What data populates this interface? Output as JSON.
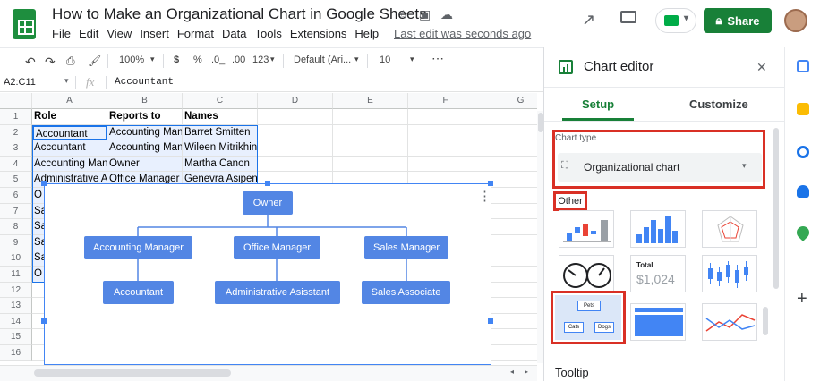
{
  "doc": {
    "title": "How to Make an Organizational Chart in Google Sheets",
    "last_edit": "Last edit was seconds ago"
  },
  "menu": [
    "File",
    "Edit",
    "View",
    "Insert",
    "Format",
    "Data",
    "Tools",
    "Extensions",
    "Help"
  ],
  "share_label": "Share",
  "toolbar": {
    "zoom": "100%",
    "currency": "$",
    "percent": "%",
    "dec_decrease": ".0_",
    "dec_increase": ".00",
    "number_format": "123",
    "font": "Default (Ari...",
    "font_size": "10",
    "more": "⋯"
  },
  "formula_bar": {
    "range": "A2:C11",
    "fx": "fx",
    "content": "Accountant"
  },
  "grid": {
    "columns": [
      "A",
      "B",
      "C",
      "D",
      "E",
      "F",
      "G"
    ],
    "rows": [
      "1",
      "2",
      "3",
      "4",
      "5",
      "6",
      "7",
      "8",
      "9",
      "10",
      "11",
      "12",
      "13",
      "14",
      "15",
      "16"
    ],
    "cells": [
      [
        "Role",
        "Reports to",
        "Names"
      ],
      [
        "Accountant",
        "Accounting Mana",
        "Barret Smitten"
      ],
      [
        "Accountant",
        "Accounting Mana",
        "Wileen Mitrikhin"
      ],
      [
        "Accounting Mana",
        "Owner",
        "Martha Canon"
      ],
      [
        "Administrative A",
        "Office Manager",
        "Genevra Asipenko"
      ],
      [
        "O",
        "",
        ""
      ],
      [
        "Sa",
        "",
        ""
      ],
      [
        "Sa",
        "",
        ""
      ],
      [
        "Sa",
        "",
        ""
      ],
      [
        "Sa",
        "",
        ""
      ],
      [
        "O",
        "",
        ""
      ]
    ]
  },
  "org_chart": {
    "root": "Owner",
    "level2": [
      "Accounting Manager",
      "Office Manager",
      "Sales Manager"
    ],
    "level3": [
      "Accountant",
      "Administrative Asisstant",
      "Sales Associate"
    ],
    "menu_icon": "⋮"
  },
  "editor": {
    "title": "Chart editor",
    "close": "✕",
    "tabs": [
      "Setup",
      "Customize"
    ],
    "chart_type_label": "Chart type",
    "chart_type_value": "Organizational chart",
    "section_other": "Other",
    "total_label": "Total",
    "total_value": "$1,024",
    "org_thumb_labels": [
      "Pets",
      "Cats",
      "Dogs"
    ],
    "tooltip_label": "Tooltip"
  },
  "colors": {
    "brand_green": "#188038",
    "node_blue": "#5386e4",
    "highlight_red": "#d93025",
    "selection_blue": "#4285f4"
  }
}
